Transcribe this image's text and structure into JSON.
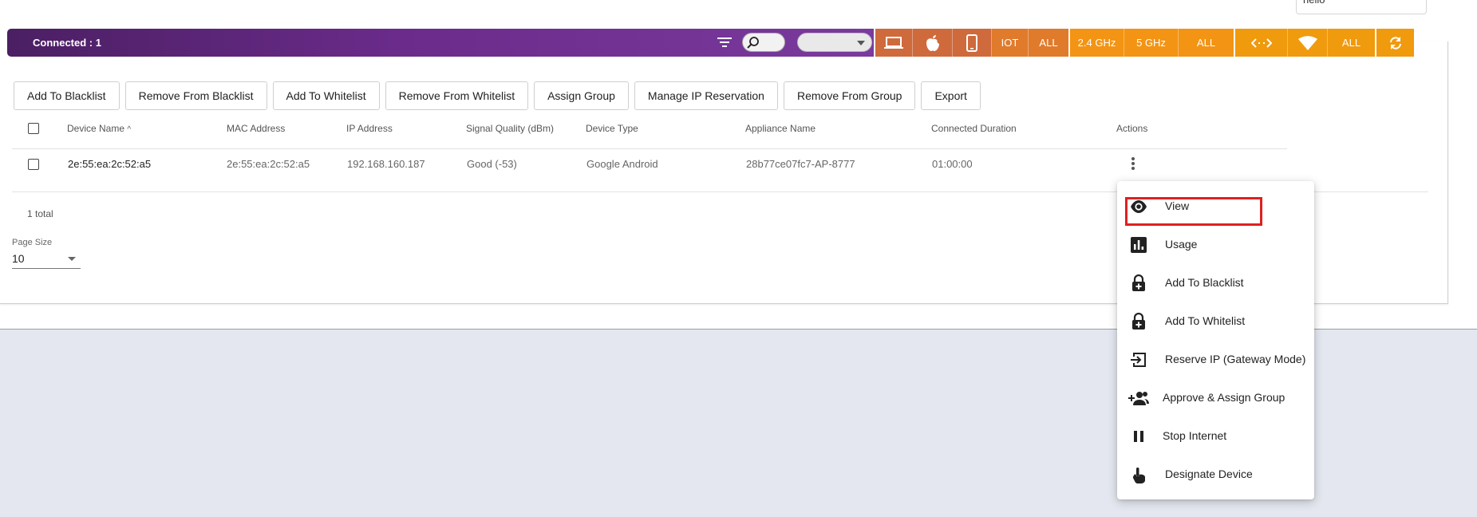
{
  "top_input": {
    "value": "hello"
  },
  "topbar": {
    "connected_label": "Connected : 1",
    "filter_icon": "filter-icon",
    "search_icon": "search-icon",
    "select_value": "",
    "device_filters": [
      {
        "icon": "laptop-icon"
      },
      {
        "icon": "apple-icon"
      },
      {
        "icon": "phone-icon"
      },
      {
        "label": "IOT"
      },
      {
        "label": "ALL"
      }
    ],
    "band_filters": [
      "2.4 GHz",
      "5 GHz",
      "ALL"
    ],
    "direction_filters": [
      {
        "icon": "bidirectional-arrows-icon"
      },
      {
        "icon": "wifi-icon"
      },
      {
        "label": "ALL"
      }
    ],
    "refresh_icon": "refresh-icon",
    "colors": {
      "purple": "#6a2b8a",
      "orange": "#f39414",
      "dark_orange": "#cf6a3c"
    }
  },
  "actions": {
    "buttons": [
      "Add To Blacklist",
      "Remove From Blacklist",
      "Add To Whitelist",
      "Remove From Whitelist",
      "Assign Group",
      "Manage IP Reservation",
      "Remove From Group",
      "Export"
    ]
  },
  "table": {
    "columns": [
      "Device Name",
      "MAC Address",
      "IP Address",
      "Signal Quality (dBm)",
      "Device Type",
      "Appliance Name",
      "Connected Duration",
      "Actions"
    ],
    "sort_indicator": "^",
    "rows": [
      {
        "device_name": "2e:55:ea:2c:52:a5",
        "mac": "2e:55:ea:2c:52:a5",
        "ip": "192.168.160.187",
        "signal": "Good (-53)",
        "device_type": "Google Android",
        "appliance": "28b77ce07fc7-AP-8777",
        "duration": "01:00:00"
      }
    ]
  },
  "footer": {
    "total": "1 total",
    "page_size_label": "Page Size",
    "page_size_value": "10"
  },
  "menu": {
    "items": [
      {
        "label": "View",
        "icon": "eye-icon"
      },
      {
        "label": "Usage",
        "icon": "bar-chart-icon"
      },
      {
        "label": "Add To Blacklist",
        "icon": "lock-plus-icon"
      },
      {
        "label": "Add To Whitelist",
        "icon": "lock-plus-icon"
      },
      {
        "label": "Reserve IP (Gateway Mode)",
        "icon": "login-arrow-icon"
      },
      {
        "label": "Approve & Assign Group",
        "icon": "group-add-icon"
      },
      {
        "label": "Stop Internet",
        "icon": "pause-icon"
      },
      {
        "label": "Designate Device",
        "icon": "touch-hand-icon"
      }
    ],
    "highlight_color": "#e02020"
  }
}
